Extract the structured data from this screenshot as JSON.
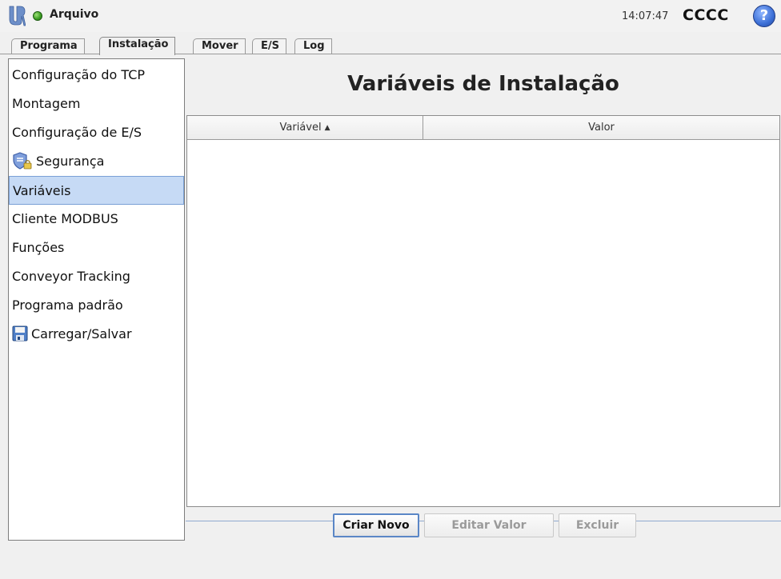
{
  "header": {
    "file_menu": "Arquivo",
    "time": "14:07:47",
    "robot_name": "CCCC",
    "help_label": "?"
  },
  "tabs": [
    {
      "label": "Programa"
    },
    {
      "label": "Instalação"
    },
    {
      "label": "Mover"
    },
    {
      "label": "E/S"
    },
    {
      "label": "Log"
    }
  ],
  "active_tab": "Instalação",
  "sidebar": {
    "items": [
      {
        "label": "Configuração do TCP"
      },
      {
        "label": "Montagem"
      },
      {
        "label": "Configuração de E/S"
      },
      {
        "label": "Segurança",
        "icon": "shield-lock-icon"
      },
      {
        "label": "Variáveis"
      },
      {
        "label": "Cliente MODBUS"
      },
      {
        "label": "Funções"
      },
      {
        "label": "Conveyor Tracking"
      },
      {
        "label": "Programa padrão"
      },
      {
        "label": "Carregar/Salvar",
        "icon": "floppy-disk-icon"
      }
    ],
    "selected": "Variáveis"
  },
  "main": {
    "title": "Variáveis de Instalação",
    "table": {
      "columns": [
        {
          "label": "Variável",
          "sort": "ascending"
        },
        {
          "label": "Valor"
        }
      ],
      "rows": []
    },
    "buttons": {
      "create": "Criar Novo",
      "edit": "Editar Valor",
      "delete": "Excluir"
    }
  },
  "colors": {
    "selection": "#c6daf5",
    "status_ok": "#3fa125",
    "help_blue": "#3c6fd6"
  }
}
